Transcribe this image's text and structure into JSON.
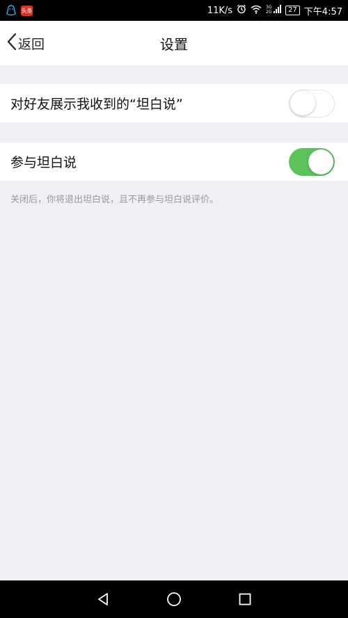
{
  "status_bar": {
    "notification_icons": [
      "app-notification-icon",
      "news-app-icon"
    ],
    "news_icon_text": "头条",
    "network_speed": "11K/s",
    "icons": [
      "alarm-icon",
      "wifi-icon",
      "signal-icon"
    ],
    "battery": "27",
    "time": "下午4:57"
  },
  "nav": {
    "back_label": "返回",
    "title": "设置"
  },
  "settings": {
    "items": [
      {
        "label": "对好友展示我收到的“坦白说”",
        "toggle_on": false
      },
      {
        "label": "参与坦白说",
        "toggle_on": true
      }
    ],
    "hint": "关闭后，你将退出坦白说，且不再参与坦白说评价。"
  },
  "colors": {
    "toggle_on": "#5ac359",
    "background": "#efeff4",
    "hint_text": "#9a9a9a"
  },
  "system_nav": {
    "buttons": [
      "back-triangle-icon",
      "home-circle-icon",
      "recents-square-icon"
    ]
  }
}
